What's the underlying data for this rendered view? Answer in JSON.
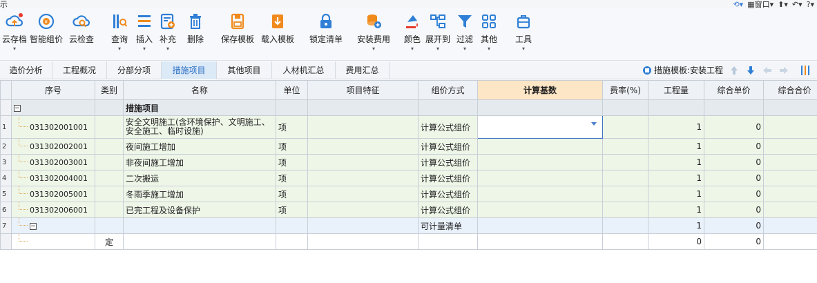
{
  "titlebar": {
    "glyph": "示",
    "window_menu": "窗口",
    "ctrl_a": "▾",
    "ctrl_b": "▾",
    "ctrl_c": "▾",
    "ctrl_d": "▾"
  },
  "ribbon": {
    "buttons": [
      {
        "label": "云存档",
        "icon": "cloud-upload-icon",
        "has_menu": true
      },
      {
        "label": "智能组价",
        "icon": "smart-pricing-icon",
        "has_menu": false
      },
      {
        "label": "云检查",
        "icon": "cloud-check-icon",
        "has_menu": false
      },
      {
        "label": "查询",
        "icon": "query-icon",
        "has_menu": true
      },
      {
        "label": "插入",
        "icon": "insert-icon",
        "has_menu": true
      },
      {
        "label": "补充",
        "icon": "supplement-icon",
        "has_menu": true
      },
      {
        "label": "删除",
        "icon": "delete-icon",
        "has_menu": false
      },
      {
        "label": "保存模板",
        "icon": "save-template-icon",
        "has_menu": false
      },
      {
        "label": "载入模板",
        "icon": "load-template-icon",
        "has_menu": false
      },
      {
        "label": "锁定清单",
        "icon": "lock-icon",
        "has_menu": false
      },
      {
        "label": "安装费用",
        "icon": "install-fee-icon",
        "has_menu": true
      },
      {
        "label": "颜色",
        "icon": "color-icon",
        "has_menu": true
      },
      {
        "label": "展开到",
        "icon": "expand-to-icon",
        "has_menu": true
      },
      {
        "label": "过滤",
        "icon": "filter-icon",
        "has_menu": true
      },
      {
        "label": "其他",
        "icon": "other-icon",
        "has_menu": true
      },
      {
        "label": "工具",
        "icon": "tools-icon",
        "has_menu": true
      }
    ],
    "colors": {
      "blue": "#2f7fd6",
      "orange": "#f08a1c",
      "red": "#e63a2e"
    }
  },
  "tabs": [
    {
      "label": "造价分析",
      "active": false
    },
    {
      "label": "工程概况",
      "active": false
    },
    {
      "label": "分部分项",
      "active": false
    },
    {
      "label": "措施项目",
      "active": true
    },
    {
      "label": "其他项目",
      "active": false
    },
    {
      "label": "人材机汇总",
      "active": false
    },
    {
      "label": "费用汇总",
      "active": false
    }
  ],
  "template_label": "措施模板:安装工程",
  "grid": {
    "columns": [
      "序号",
      "类别",
      "名称",
      "单位",
      "项目特征",
      "组价方式",
      "计算基数",
      "费率(%)",
      "工程量",
      "综合单价",
      "综合合价"
    ],
    "group_title": "措施项目",
    "rows": [
      {
        "rn": "1",
        "code": "031302001001",
        "type": "",
        "name": "安全文明施工(含环境保护、文明施工、安全施工、临时设施)",
        "unit": "项",
        "feature": "",
        "method": "计算公式组价",
        "base": "",
        "rate": "",
        "qty": "1",
        "price": "0",
        "total": ""
      },
      {
        "rn": "2",
        "code": "031302002001",
        "type": "",
        "name": "夜间施工增加",
        "unit": "项",
        "feature": "",
        "method": "计算公式组价",
        "base": "",
        "rate": "",
        "qty": "1",
        "price": "0",
        "total": ""
      },
      {
        "rn": "3",
        "code": "031302003001",
        "type": "",
        "name": "非夜间施工增加",
        "unit": "项",
        "feature": "",
        "method": "计算公式组价",
        "base": "",
        "rate": "",
        "qty": "1",
        "price": "0",
        "total": ""
      },
      {
        "rn": "4",
        "code": "031302004001",
        "type": "",
        "name": "二次搬运",
        "unit": "项",
        "feature": "",
        "method": "计算公式组价",
        "base": "",
        "rate": "",
        "qty": "1",
        "price": "0",
        "total": ""
      },
      {
        "rn": "5",
        "code": "031302005001",
        "type": "",
        "name": "冬雨季施工增加",
        "unit": "项",
        "feature": "",
        "method": "计算公式组价",
        "base": "",
        "rate": "",
        "qty": "1",
        "price": "0",
        "total": ""
      },
      {
        "rn": "6",
        "code": "031302006001",
        "type": "",
        "name": "已完工程及设备保护",
        "unit": "项",
        "feature": "",
        "method": "计算公式组价",
        "base": "",
        "rate": "",
        "qty": "1",
        "price": "0",
        "total": ""
      },
      {
        "rn": "7",
        "code": "",
        "type": "",
        "name": "",
        "unit": "",
        "feature": "",
        "method": "可计量清单",
        "base": "",
        "rate": "",
        "qty": "1",
        "price": "0",
        "total": ""
      },
      {
        "rn": "",
        "code": "",
        "type": "定",
        "name": "",
        "unit": "",
        "feature": "",
        "method": "",
        "base": "",
        "rate": "",
        "qty": "0",
        "price": "0",
        "total": ""
      }
    ]
  }
}
